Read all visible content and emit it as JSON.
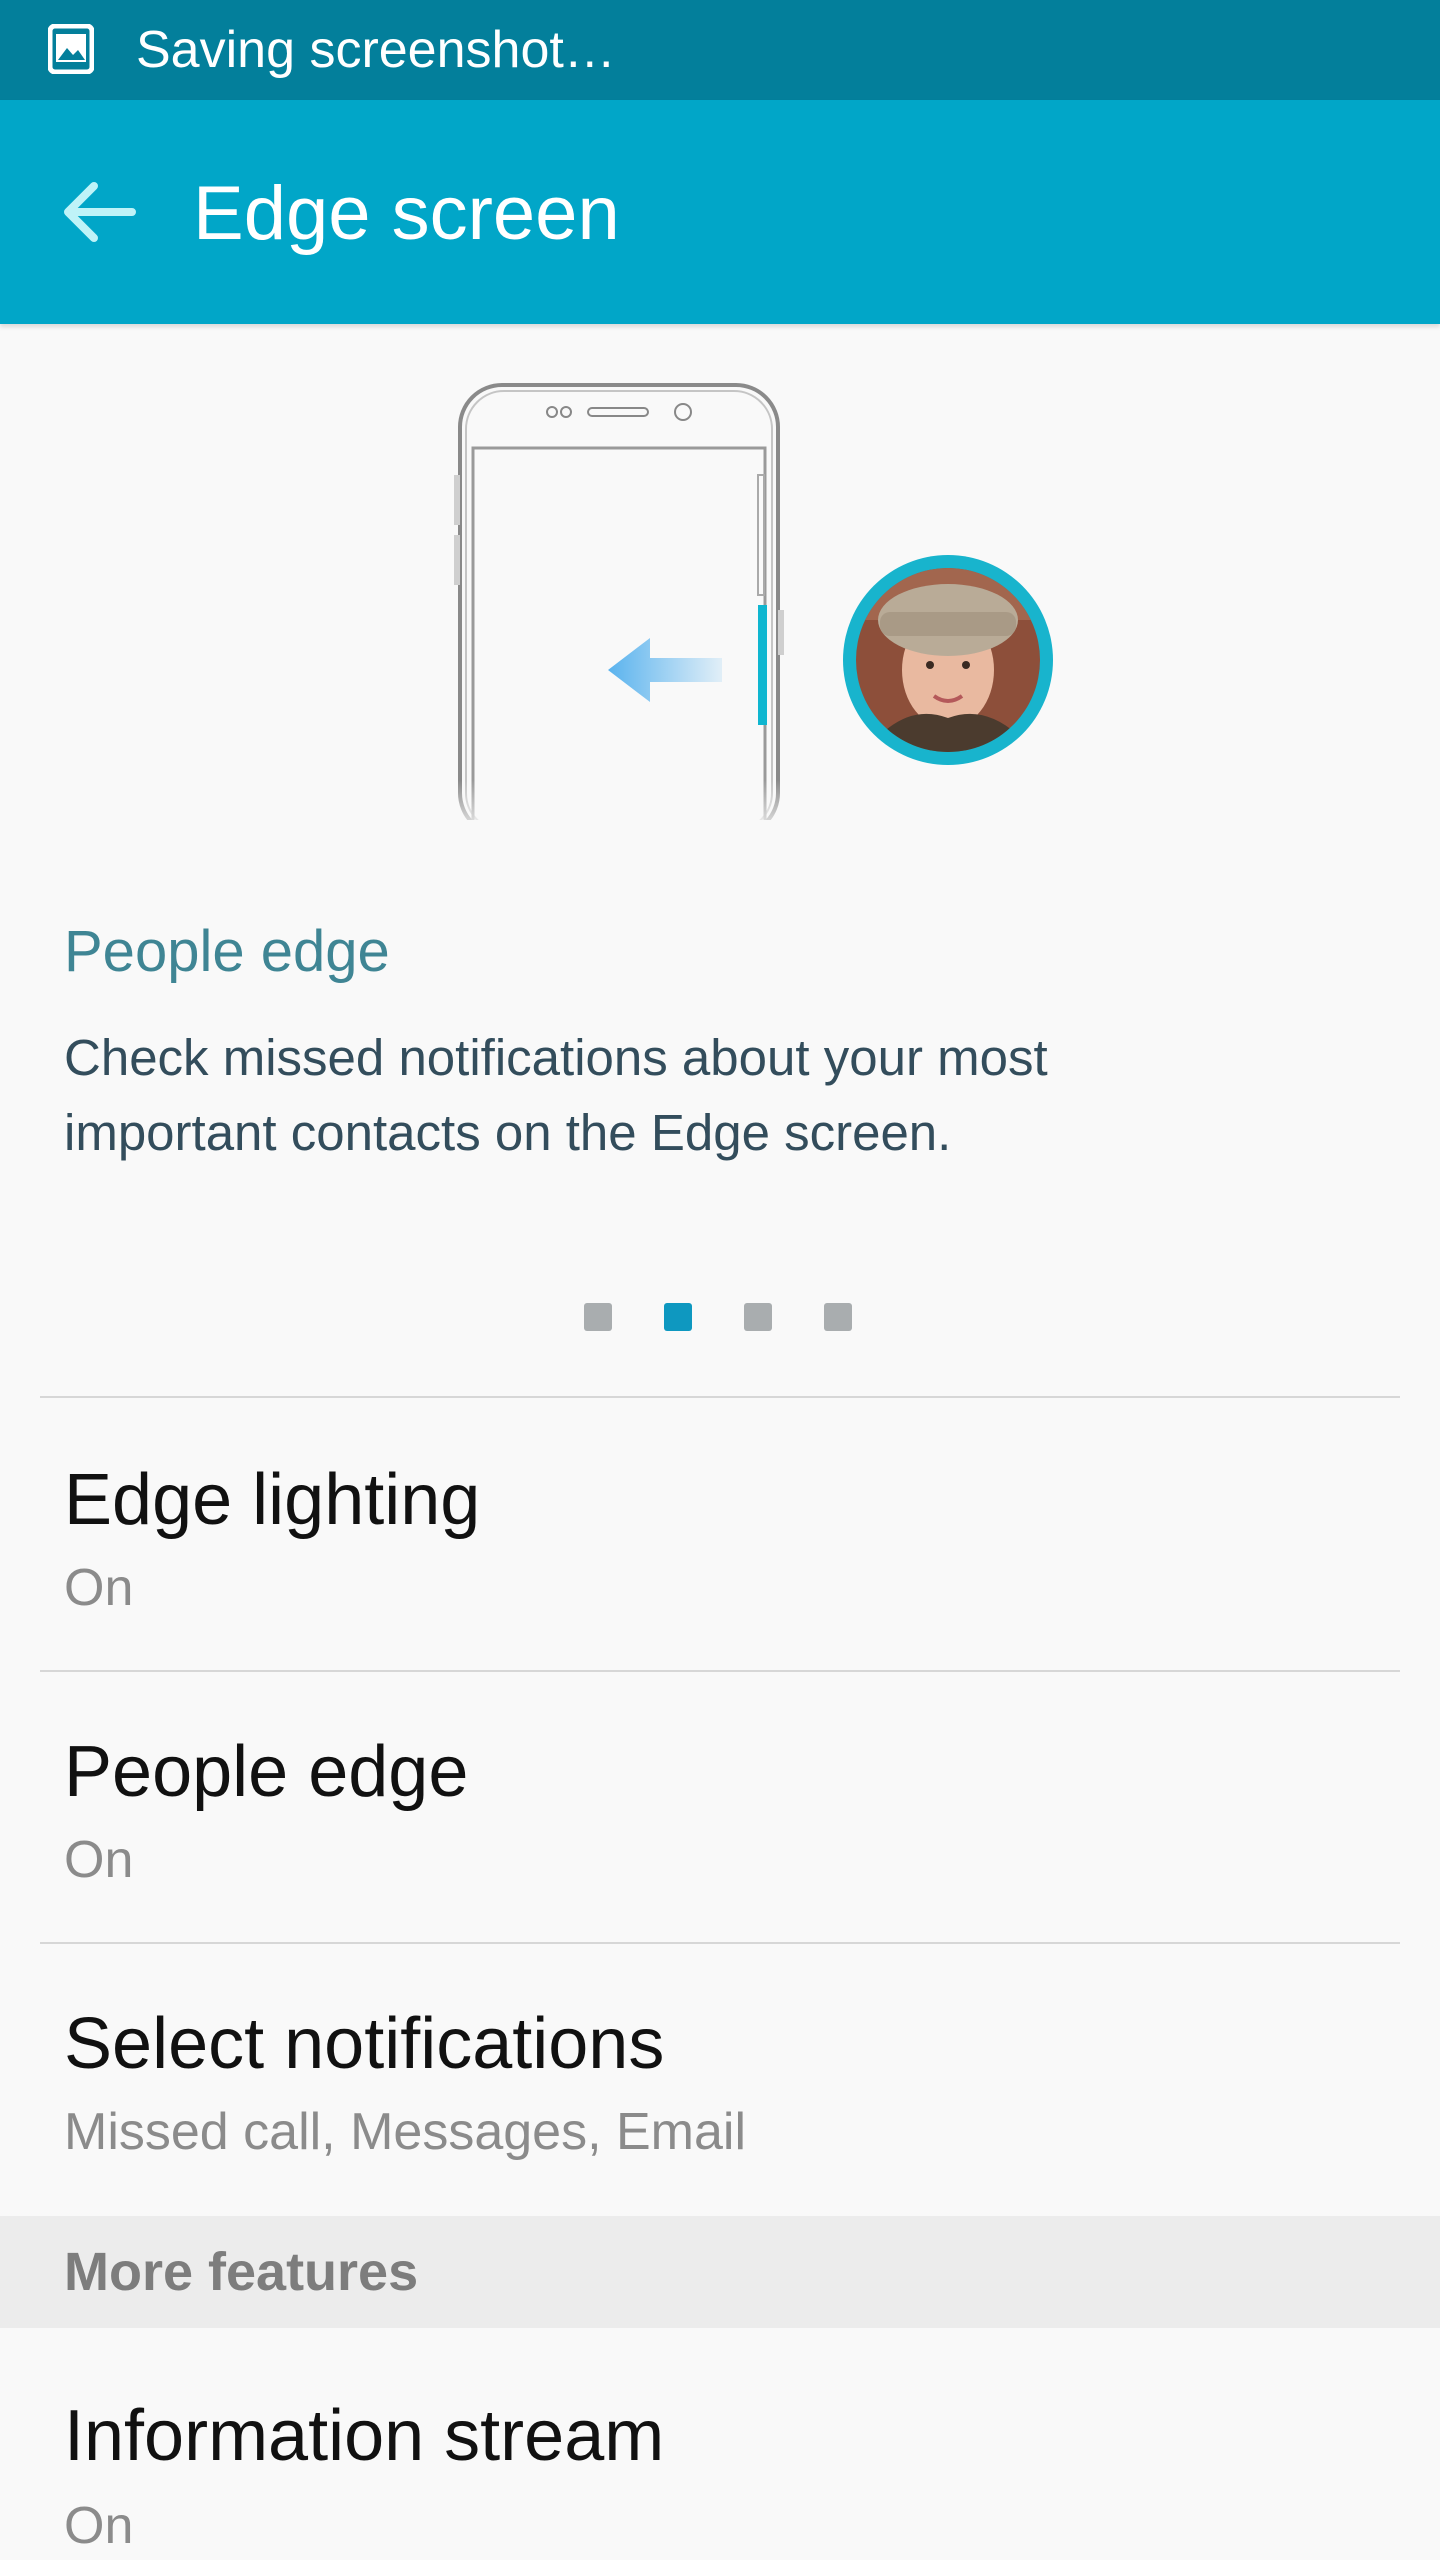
{
  "status_bar": {
    "text": "Saving screenshot…",
    "icon": "image-icon"
  },
  "app_bar": {
    "title": "Edge screen",
    "back_icon": "back-arrow-icon"
  },
  "illustration": {
    "icons": [
      "phone-outline-icon",
      "swipe-left-arrow-icon",
      "contact-avatar"
    ]
  },
  "feature_card": {
    "heading": "People edge",
    "description_line1": "Check missed notifications about your most",
    "description_line2": "important contacts on the Edge screen.",
    "pages": 4,
    "active_page": 2
  },
  "settings": [
    {
      "title": "Edge lighting",
      "subtitle": "On"
    },
    {
      "title": "People edge",
      "subtitle": "On"
    },
    {
      "title": "Select notifications",
      "subtitle": "Missed call, Messages, Email"
    }
  ],
  "section_header": "More features",
  "more_features": [
    {
      "title": "Information stream",
      "subtitle": "On"
    }
  ],
  "colors": {
    "status_bar": "#037f9b",
    "app_bar": "#01a6c8",
    "accent": "#0e98c0",
    "avatar_ring": "#1ab5cf"
  }
}
